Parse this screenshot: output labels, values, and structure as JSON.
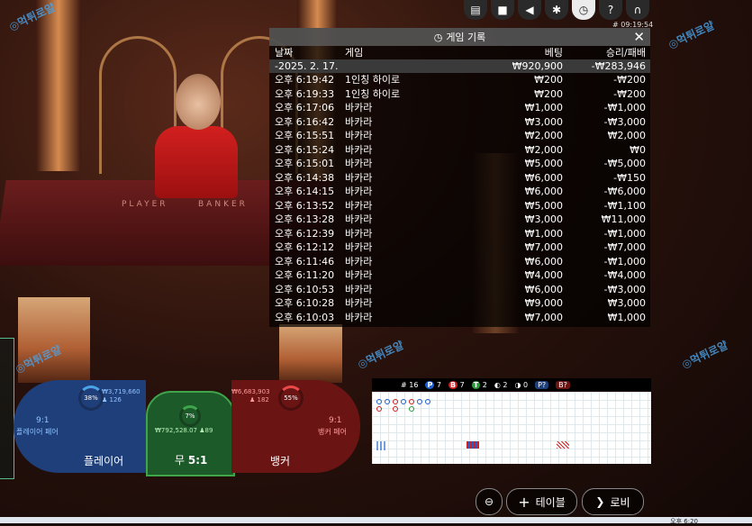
{
  "controls": {
    "icons": [
      "chat-icon",
      "video-icon",
      "sound-icon",
      "gear-icon",
      "history-icon",
      "help-icon",
      "headset-icon"
    ],
    "time": "# 09:19:54"
  },
  "scene": {
    "felt_left": "PLAYER",
    "felt_right": "BANKER"
  },
  "history": {
    "title": "게임 기록",
    "headers": {
      "date": "날짜",
      "game": "게임",
      "bet": "베팅",
      "winloss": "승리/패배"
    },
    "date_row": {
      "date": "-2025. 2. 17.",
      "bet": "₩920,900",
      "winloss": "-₩283,946"
    },
    "rows": [
      {
        "time": "오후 6:19:42",
        "game": "1인칭 하이로",
        "bet": "₩200",
        "winloss": "-₩200"
      },
      {
        "time": "오후 6:19:33",
        "game": "1인칭 하이로",
        "bet": "₩200",
        "winloss": "-₩200"
      },
      {
        "time": "오후 6:17:06",
        "game": "바카라",
        "bet": "₩1,000",
        "winloss": "-₩1,000"
      },
      {
        "time": "오후 6:16:42",
        "game": "바카라",
        "bet": "₩3,000",
        "winloss": "-₩3,000"
      },
      {
        "time": "오후 6:15:51",
        "game": "바카라",
        "bet": "₩2,000",
        "winloss": "₩2,000"
      },
      {
        "time": "오후 6:15:24",
        "game": "바카라",
        "bet": "₩2,000",
        "winloss": "₩0"
      },
      {
        "time": "오후 6:15:01",
        "game": "바카라",
        "bet": "₩5,000",
        "winloss": "-₩5,000"
      },
      {
        "time": "오후 6:14:38",
        "game": "바카라",
        "bet": "₩6,000",
        "winloss": "-₩150"
      },
      {
        "time": "오후 6:14:15",
        "game": "바카라",
        "bet": "₩6,000",
        "winloss": "-₩6,000"
      },
      {
        "time": "오후 6:13:52",
        "game": "바카라",
        "bet": "₩5,000",
        "winloss": "-₩1,100"
      },
      {
        "time": "오후 6:13:28",
        "game": "바카라",
        "bet": "₩3,000",
        "winloss": "₩11,000"
      },
      {
        "time": "오후 6:12:39",
        "game": "바카라",
        "bet": "₩1,000",
        "winloss": "-₩1,000"
      },
      {
        "time": "오후 6:12:12",
        "game": "바카라",
        "bet": "₩7,000",
        "winloss": "-₩7,000"
      },
      {
        "time": "오후 6:11:46",
        "game": "바카라",
        "bet": "₩6,000",
        "winloss": "-₩1,000"
      },
      {
        "time": "오후 6:11:20",
        "game": "바카라",
        "bet": "₩4,000",
        "winloss": "-₩4,000"
      },
      {
        "time": "오후 6:10:53",
        "game": "바카라",
        "bet": "₩6,000",
        "winloss": "-₩3,000"
      },
      {
        "time": "오후 6:10:28",
        "game": "바카라",
        "bet": "₩9,000",
        "winloss": "₩3,000"
      },
      {
        "time": "오후 6:10:03",
        "game": "바카라",
        "bet": "₩7,000",
        "winloss": "₩1,000"
      }
    ]
  },
  "betting": {
    "player_pair_ratio": "9:1",
    "player_pair_label": "플레이어 페어",
    "player_label": "플레이어",
    "player_pct": "38%",
    "player_amount": "₩3,719,660",
    "player_count": "126",
    "tie_label": "무",
    "tie_ratio": "5:1",
    "tie_pct": "7%",
    "tie_amount": "₩792,528.07",
    "tie_count": "89",
    "banker_label": "뱅커",
    "banker_pct": "55%",
    "banker_amount": "₩6,683,903",
    "banker_count": "182",
    "banker_pair_ratio": "9:1",
    "banker_pair_label": "뱅커 페어",
    "colors": {
      "player": "#1f3f7a",
      "tie": "#1c5a2a",
      "banker": "#6a1414"
    }
  },
  "roadmap": {
    "round": "# 16",
    "p_label": "P",
    "p_count": "7",
    "b_label": "B",
    "b_count": "7",
    "t_label": "T",
    "t_count": "2",
    "pp_count": "2",
    "bp_count": "0",
    "p_ask": "P?",
    "b_ask": "B?"
  },
  "bottom": {
    "tables_label": "테이블",
    "lobby_label": "로비"
  },
  "taskbar": {
    "time": "오후 6:20"
  }
}
